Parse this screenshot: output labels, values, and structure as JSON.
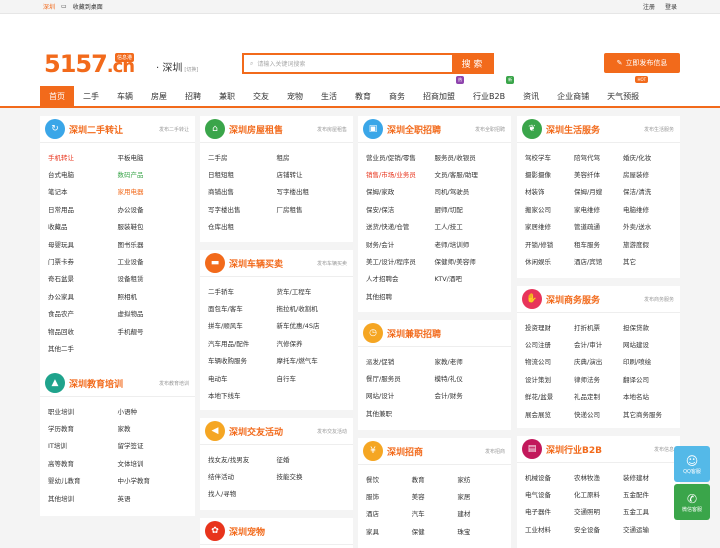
{
  "topbar": {
    "city": "深圳",
    "bookmark": "收藏到桌面",
    "register": "注册",
    "login": "登录"
  },
  "header": {
    "logo_main": "5157",
    "logo_tld": ".cn",
    "logo_badge": "信息港",
    "city": "深圳",
    "switch": "[切换]",
    "search_placeholder": "请输入关键词搜索",
    "search_button": "搜 索",
    "post_button": "立即发布信息"
  },
  "nav": [
    {
      "label": "首页",
      "active": true
    },
    {
      "label": "二手"
    },
    {
      "label": "车辆"
    },
    {
      "label": "房屋"
    },
    {
      "label": "招聘"
    },
    {
      "label": "兼职"
    },
    {
      "label": "交友"
    },
    {
      "label": "宠物"
    },
    {
      "label": "生活"
    },
    {
      "label": "教育"
    },
    {
      "label": "商务"
    },
    {
      "label": "招商加盟",
      "tag": "热",
      "tag_color": "#8e44ad"
    },
    {
      "label": "行业B2B",
      "tag": "新",
      "tag_color": "#3aa54a"
    },
    {
      "label": "资讯"
    },
    {
      "label": "企业商铺"
    },
    {
      "label": "天气预报",
      "tag": "HOT",
      "tag_color": "#f26a1b"
    }
  ],
  "cards": {
    "ershou": {
      "title": "深圳二手转让",
      "more": "发布二手转让",
      "icon": "recycle-icon",
      "color": "#3aa6e8",
      "items": [
        {
          "t": "手机转让",
          "c": "red"
        },
        {
          "t": "平板电脑"
        },
        {
          "t": "台式电脑"
        },
        {
          "t": "数码产品",
          "c": "green"
        },
        {
          "t": "笔记本"
        },
        {
          "t": "家用电器",
          "c": "orange"
        },
        {
          "t": "日常用品"
        },
        {
          "t": "办公设备"
        },
        {
          "t": "收藏品"
        },
        {
          "t": "服装鞋包"
        },
        {
          "t": "母婴玩具"
        },
        {
          "t": "图书乐器"
        },
        {
          "t": "门票卡券"
        },
        {
          "t": "工业设备"
        },
        {
          "t": "奇石盆景"
        },
        {
          "t": "设备租赁"
        },
        {
          "t": "办公家具"
        },
        {
          "t": "照相机"
        },
        {
          "t": "食品农产"
        },
        {
          "t": "虚拟物品"
        },
        {
          "t": "物品回收"
        },
        {
          "t": "手机靓号"
        },
        {
          "t": "其他二手"
        }
      ]
    },
    "jiaoyu": {
      "title": "深圳教育培训",
      "more": "发布教育培训",
      "icon": "graduation-icon",
      "color": "#1fa38c",
      "items": [
        {
          "t": "职业培训"
        },
        {
          "t": "小语种"
        },
        {
          "t": "学历教育"
        },
        {
          "t": "家教"
        },
        {
          "t": "IT培训"
        },
        {
          "t": "留学签证"
        },
        {
          "t": "高等教育"
        },
        {
          "t": "文体培训"
        },
        {
          "t": "婴幼儿教育"
        },
        {
          "t": "中小学教育"
        },
        {
          "t": "其他培训"
        },
        {
          "t": "英语"
        }
      ]
    },
    "fangwu": {
      "title": "深圳房屋租售",
      "more": "发布房屋租售",
      "icon": "house-icon",
      "color": "#3aa54a",
      "items": [
        {
          "t": "二手房"
        },
        {
          "t": "租房"
        },
        {
          "t": "日租短租"
        },
        {
          "t": "店铺转让"
        },
        {
          "t": "商铺出售"
        },
        {
          "t": "写字楼出租"
        },
        {
          "t": "写字楼出售"
        },
        {
          "t": "厂房租售"
        },
        {
          "t": "仓库出租"
        }
      ]
    },
    "cheliang": {
      "title": "深圳车辆买卖",
      "more": "发布车辆买卖",
      "icon": "car-icon",
      "color": "#f26a1b",
      "items": [
        {
          "t": "二手轿车"
        },
        {
          "t": "货车/工程车"
        },
        {
          "t": "面包车/客车"
        },
        {
          "t": "拖拉机/收割机"
        },
        {
          "t": "拼车/顺风车"
        },
        {
          "t": "新车优惠/4S店"
        },
        {
          "t": "汽车用品/配件"
        },
        {
          "t": "汽修保养"
        },
        {
          "t": "车辆收购服务"
        },
        {
          "t": "摩托车/燃气车"
        },
        {
          "t": "电动车"
        },
        {
          "t": "自行车"
        },
        {
          "t": "本地下线车"
        }
      ]
    },
    "jiaoyou": {
      "title": "深圳交友活动",
      "more": "发布交友活动",
      "icon": "megaphone-icon",
      "color": "#f5a623",
      "items": [
        {
          "t": "找女友/找男友"
        },
        {
          "t": "征婚"
        },
        {
          "t": "结伴活动"
        },
        {
          "t": "技能交换"
        },
        {
          "t": "找人/寻物"
        }
      ]
    },
    "chongwu": {
      "title": "深圳宠物",
      "more": "",
      "icon": "paw-icon",
      "color": "#e8341c",
      "items": []
    },
    "zhaopin": {
      "title": "深圳全职招聘",
      "more": "发布全职招聘",
      "icon": "briefcase-icon",
      "color": "#3aa6e8",
      "items": [
        {
          "t": "营业员/促销/零售"
        },
        {
          "t": "服务员/收银员"
        },
        {
          "t": "销售/市场/业务员",
          "c": "red"
        },
        {
          "t": "文员/客服/助理"
        },
        {
          "t": "保姆/家政"
        },
        {
          "t": "司机/驾驶员"
        },
        {
          "t": "保安/保洁"
        },
        {
          "t": "厨师/切配"
        },
        {
          "t": "送货/快递/仓管"
        },
        {
          "t": "工人/技工"
        },
        {
          "t": "财务/会计"
        },
        {
          "t": "老师/培训师"
        },
        {
          "t": "美工/设计/程序员"
        },
        {
          "t": "保健师/美容师"
        },
        {
          "t": "人才招聘会"
        },
        {
          "t": "KTV/酒吧"
        },
        {
          "t": "其他招聘"
        }
      ]
    },
    "jianzhi": {
      "title": "深圳兼职招聘",
      "more": "",
      "icon": "clock-icon",
      "color": "#f5a623",
      "items": [
        {
          "t": "派发/促销"
        },
        {
          "t": "家教/老师"
        },
        {
          "t": "餐厅/服务员"
        },
        {
          "t": "模特/礼仪"
        },
        {
          "t": "网站/设计"
        },
        {
          "t": "会计/财务"
        },
        {
          "t": "其他兼职"
        }
      ]
    },
    "zhaoshang": {
      "title": "深圳招商",
      "more": "发布招商",
      "icon": "money-bag-icon",
      "color": "#f5a623",
      "items": [
        {
          "t": "餐饮"
        },
        {
          "t": "教育"
        },
        {
          "t": "家纺"
        },
        {
          "t": "服饰"
        },
        {
          "t": "美容"
        },
        {
          "t": "家居"
        },
        {
          "t": "酒店"
        },
        {
          "t": "汽车"
        },
        {
          "t": "建材"
        },
        {
          "t": "家具"
        },
        {
          "t": "保健"
        },
        {
          "t": "珠宝"
        }
      ]
    },
    "shenghuo": {
      "title": "深圳生活服务",
      "more": "发布生活服务",
      "icon": "leaf-icon",
      "color": "#3aa54a",
      "items": [
        {
          "t": "驾校学车"
        },
        {
          "t": "陪驾代驾"
        },
        {
          "t": "婚庆/化妆"
        },
        {
          "t": "摄影摄像"
        },
        {
          "t": "美容纤体"
        },
        {
          "t": "房屋装修"
        },
        {
          "t": "材装饰"
        },
        {
          "t": "保姆/月嫂"
        },
        {
          "t": "保洁/清洗"
        },
        {
          "t": "搬家公司"
        },
        {
          "t": "家电维修"
        },
        {
          "t": "电脑维修"
        },
        {
          "t": "家居维修"
        },
        {
          "t": "管道疏通"
        },
        {
          "t": "外卖/送水"
        },
        {
          "t": "开锁/修锁"
        },
        {
          "t": "租车服务"
        },
        {
          "t": "旅游度假"
        },
        {
          "t": "休闲娱乐"
        },
        {
          "t": "酒店/宾馆"
        },
        {
          "t": "其它"
        }
      ]
    },
    "shangwu": {
      "title": "深圳商务服务",
      "more": "发布商务服务",
      "icon": "handshake-icon",
      "color": "#e8345a",
      "items": [
        {
          "t": "投资理财"
        },
        {
          "t": "打折机票"
        },
        {
          "t": "担保贷款"
        },
        {
          "t": "公司注册"
        },
        {
          "t": "会计/审计"
        },
        {
          "t": "网站建设"
        },
        {
          "t": "物流公司"
        },
        {
          "t": "庆典/演出"
        },
        {
          "t": "印刷/喷绘"
        },
        {
          "t": "设计策划"
        },
        {
          "t": "律师法务"
        },
        {
          "t": "翻译公司"
        },
        {
          "t": "鲜花/盆景"
        },
        {
          "t": "礼品定制"
        },
        {
          "t": "本地名站"
        },
        {
          "t": "展会展览"
        },
        {
          "t": "快递公司"
        },
        {
          "t": "其它商务服务"
        }
      ]
    },
    "b2b": {
      "title": "深圳行业B2B",
      "more": "发布信息",
      "icon": "factory-icon",
      "color": "#c2185b",
      "items": [
        {
          "t": "机械设备"
        },
        {
          "t": "农林牧渔"
        },
        {
          "t": "装修建材"
        },
        {
          "t": "电气设备"
        },
        {
          "t": "化工原料"
        },
        {
          "t": "五金配件"
        },
        {
          "t": "电子器件"
        },
        {
          "t": "交通照明"
        },
        {
          "t": "五金工具"
        },
        {
          "t": "工业材料"
        },
        {
          "t": "安全设备"
        },
        {
          "t": "交通运输"
        }
      ]
    }
  },
  "float": {
    "qq": "QQ客服",
    "wechat": "微信客服"
  }
}
